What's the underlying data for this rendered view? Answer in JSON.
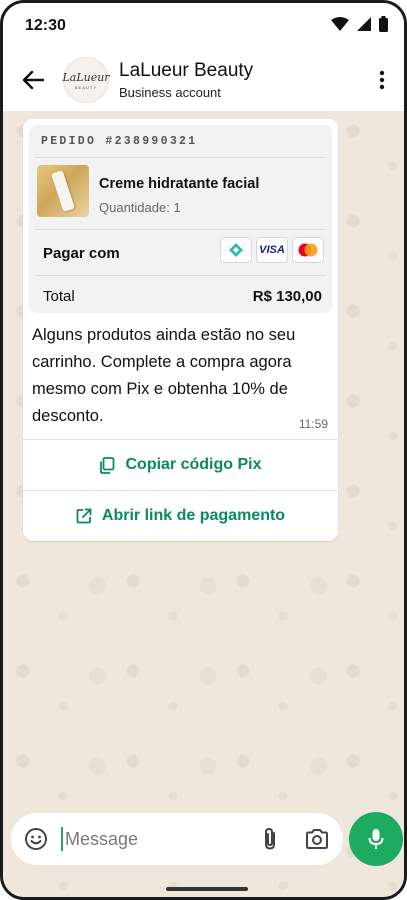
{
  "status_bar": {
    "time": "12:30"
  },
  "header": {
    "contact_name": "LaLueur Beauty",
    "subtitle": "Business account",
    "avatar_logo": "LaLueur",
    "avatar_sub": "BEAUTY"
  },
  "order": {
    "order_id": "PEDIDO #238990321",
    "product_name": "Creme hidratante facial",
    "quantity": "Quantidade: 1",
    "pay_label": "Pagar com",
    "visa": "VISA",
    "total_label": "Total",
    "total_value": "R$ 130,00"
  },
  "message": {
    "text": "Alguns produtos ainda estão no seu carrinho. Complete a compra agora mesmo com Pix e obtenha 10% de desconto.",
    "time": "11:59"
  },
  "actions": {
    "copy_pix": "Copiar código Pix",
    "open_link": "Abrir link de pagamento"
  },
  "composer": {
    "placeholder": "Message"
  },
  "colors": {
    "accent": "#1daa61",
    "action_text": "#0b8a5f",
    "wallpaper": "#efe6dc"
  }
}
